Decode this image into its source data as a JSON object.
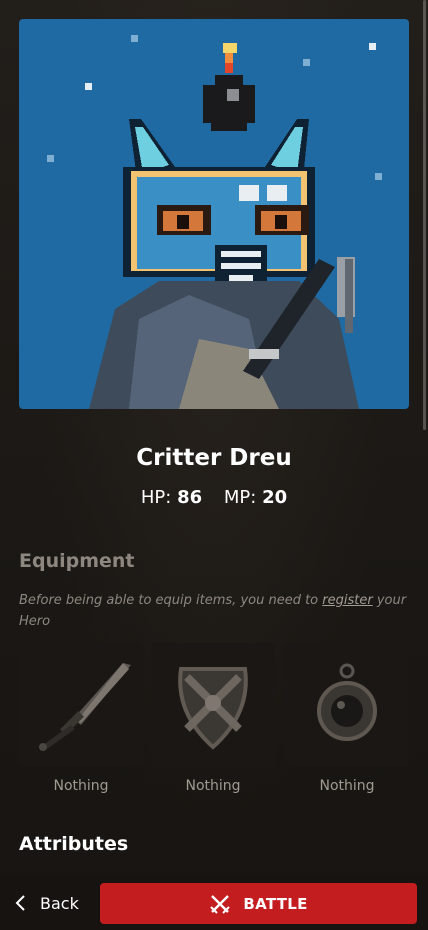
{
  "hero": {
    "name": "Critter Dreu",
    "hp_label": "HP:",
    "hp_value": "86",
    "mp_label": "MP:",
    "mp_value": "20"
  },
  "equipment": {
    "title": "Equipment",
    "notice_before": "Before being able to equip items, you need to ",
    "notice_link": "register",
    "notice_after": " your Hero",
    "slots": [
      {
        "icon": "sword-icon",
        "label": "Nothing"
      },
      {
        "icon": "shield-icon",
        "label": "Nothing"
      },
      {
        "icon": "amulet-icon",
        "label": "Nothing"
      }
    ]
  },
  "attributes": {
    "title": "Attributes"
  },
  "nav": {
    "back_label": "Back",
    "battle_label": "BATTLE"
  },
  "colors": {
    "portrait_bg": "#1f6aa3",
    "battle_button": "#c41d1f",
    "muted_text": "#8e8780"
  }
}
